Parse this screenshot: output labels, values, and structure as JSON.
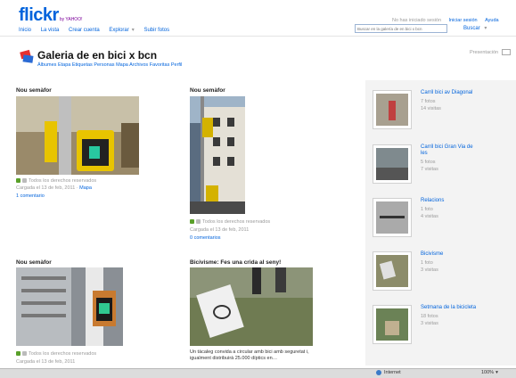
{
  "header": {
    "logo_main": "flickr",
    "logo_sub": "by YAHOO!",
    "nav": [
      "Inicio",
      "La vista",
      "Crear cuenta",
      "Explorar",
      "Subir fotos"
    ],
    "top_links": [
      "No has iniciado sesión",
      "Iniciar sesión",
      "Ayuda"
    ],
    "search_placeholder": "Buscar en la galería de en bici x bcn",
    "search_button": "Buscar"
  },
  "gallery": {
    "title": "Galeria de en bici x bcn",
    "subnav": [
      "Álbumes",
      "Etapa",
      "Etiquetas",
      "Personas",
      "Mapa",
      "Archivos",
      "Favoritas",
      "Perfil"
    ],
    "slideshow": "Presentación"
  },
  "photos": [
    {
      "title": "Nou semàfor",
      "license": "Todos los derechos reservados",
      "subido": "Cargada el 13 de feb, 2011",
      "extra": "Mapa",
      "comments": "1 comentario",
      "colors": {
        "bg": "#9a8a6a",
        "accent": "#e8c400"
      }
    },
    {
      "title": "Nou semàfor",
      "license": "Todos los derechos reservados",
      "subido": "Cargada el 13 de feb, 2011",
      "extra": "",
      "comments": "0 comentarios",
      "colors": {
        "bg": "#5a6c80",
        "accent": "#d4b200"
      }
    },
    {
      "title": "Nou semàfor",
      "license": "Todos los derechos reservados",
      "subido": "Cargada el 13 de feb, 2011",
      "extra": "",
      "comments": "",
      "colors": {
        "bg": "#8a8f95",
        "accent": "#c87a30"
      }
    },
    {
      "title": "Bicivisme: Fes una crida al seny!",
      "caption": "Un tàcaleg convida a circular amb bici amb seguretat i, igualment distribuirà 25.000 díptics en…",
      "colors": {
        "bg": "#6f7b52",
        "accent": "#f0f0f0"
      }
    }
  ],
  "sets": [
    {
      "title": "Carril bici av Diagonal",
      "line1": "7 fotos",
      "line2": "14 visitas",
      "colors": {
        "bg": "#a8a090",
        "accent": "#c04040"
      }
    },
    {
      "title": "Carril bici Gran Via de les",
      "line1": "5 fotos",
      "line2": "7 visitas",
      "colors": {
        "bg": "#7f8a8e",
        "accent": "#555555"
      }
    },
    {
      "title": "Relacions",
      "line1": "1 foto",
      "line2": "4 visitas",
      "colors": {
        "bg": "#aaaaaa",
        "accent": "#333333"
      }
    },
    {
      "title": "Bicivisme",
      "line1": "1 foto",
      "line2": "3 visitas",
      "colors": {
        "bg": "#8c8c6a",
        "accent": "#e0e0e0"
      }
    },
    {
      "title": "Setmana de la bicicleta",
      "line1": "18 fotos",
      "line2": "3 visitas",
      "colors": {
        "bg": "#6b8256",
        "accent": "#c0b090"
      }
    }
  ],
  "taskbar": {
    "item": "Internet",
    "zoom": "100%"
  }
}
